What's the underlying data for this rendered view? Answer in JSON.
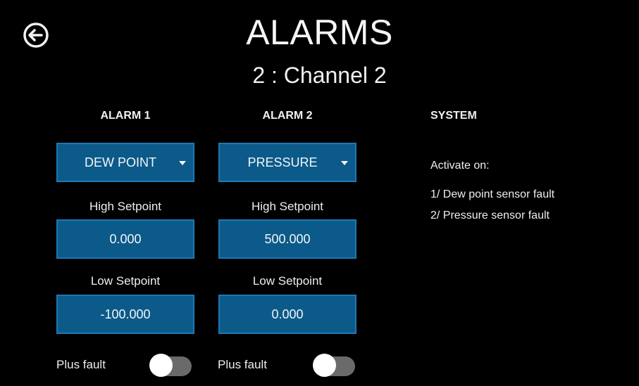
{
  "header": {
    "back_icon": "back-arrow-circle-icon",
    "title": "ALARMS",
    "subtitle": "2 : Channel 2"
  },
  "alarm1": {
    "header": "ALARM 1",
    "type_value": "DEW POINT",
    "high_label": "High Setpoint",
    "high_value": "0.000",
    "low_label": "Low Setpoint",
    "low_value": "-100.000",
    "fault_label": "Plus fault",
    "fault_on": false
  },
  "alarm2": {
    "header": "ALARM 2",
    "type_value": "PRESSURE",
    "high_label": "High Setpoint",
    "high_value": "500.000",
    "low_label": "Low Setpoint",
    "low_value": "0.000",
    "fault_label": "Plus fault",
    "fault_on": false
  },
  "system": {
    "header": "SYSTEM",
    "activate_label": "Activate on:",
    "items": [
      "1/ Dew point sensor fault",
      "2/ Pressure sensor fault"
    ]
  },
  "colors": {
    "background": "#000000",
    "field_fill": "#0b5a8a",
    "field_border": "#1e78b4",
    "text": "#f2f2f2",
    "toggle_off_track": "#6a6a6a"
  }
}
